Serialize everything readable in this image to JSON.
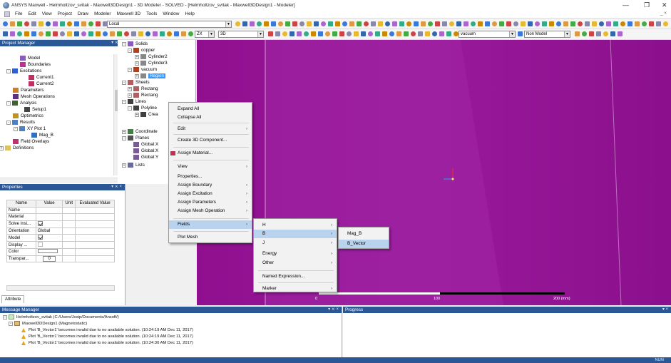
{
  "window": {
    "title": "ANSYS Maxwell - Helmholtzov_svitak - Maxwell3DDesign1 - 3D Modeler - SOLVED - [Helmholtzov_svitak - Maxwell3DDesign1 - Modeler]",
    "minimize": "—",
    "maximize": "❐",
    "close": "✕",
    "inner_controls": "_ ×"
  },
  "menubar": [
    "File",
    "Edit",
    "View",
    "Project",
    "Draw",
    "Modeler",
    "Maxwell 3D",
    "Tools",
    "Window",
    "Help"
  ],
  "toolbar": {
    "coord_system": "Local",
    "plane": "ZX",
    "dimension": "3D",
    "material": "vacuum",
    "model_type": "Non Model"
  },
  "project_manager": {
    "header": "Project Manager",
    "controls": "▾ ⨯ ×",
    "items": [
      {
        "label": "Model",
        "icon": "model-icon"
      },
      {
        "label": "Boundaries",
        "icon": "boundaries-icon"
      },
      {
        "label": "Excitations",
        "icon": "excitations-icon"
      },
      {
        "label": "Current1",
        "icon": "current-icon"
      },
      {
        "label": "Current2",
        "icon": "current-icon"
      },
      {
        "label": "Parameters",
        "icon": "parameters-icon"
      },
      {
        "label": "Mesh Operations",
        "icon": "mesh-icon"
      },
      {
        "label": "Analysis",
        "icon": "analysis-icon"
      },
      {
        "label": "Setup1",
        "icon": "setup-icon"
      },
      {
        "label": "Optimetrics",
        "icon": "optimetrics-icon"
      },
      {
        "label": "Results",
        "icon": "results-icon"
      },
      {
        "label": "XY Plot 1",
        "icon": "plot-icon"
      },
      {
        "label": "Mag_B",
        "icon": "trace-icon"
      },
      {
        "label": "Field Overlays",
        "icon": "field-icon"
      },
      {
        "label": "Definitions",
        "icon": "folder-icon"
      }
    ]
  },
  "object_tree": {
    "items": [
      {
        "label": "Solids"
      },
      {
        "label": "copper"
      },
      {
        "label": "Cylinder2"
      },
      {
        "label": "Cylinder3"
      },
      {
        "label": "vacuum"
      },
      {
        "label": "Region"
      },
      {
        "label": "Sheets"
      },
      {
        "label": "Rectang"
      },
      {
        "label": "Rectang"
      },
      {
        "label": "Lines"
      },
      {
        "label": "Polyline"
      },
      {
        "label": "Crea"
      },
      {
        "label": "Coordinate"
      },
      {
        "label": "Planes"
      },
      {
        "label": "Global:X"
      },
      {
        "label": "Global:X"
      },
      {
        "label": "Global:Y"
      },
      {
        "label": "Lists"
      }
    ]
  },
  "properties": {
    "header": "Properties",
    "controls": "▾ ⨯ ×",
    "columns": [
      "Name",
      "Value",
      "Unit",
      "Evaluated Value"
    ],
    "rows": [
      {
        "name": "Name",
        "value": ""
      },
      {
        "name": "Material",
        "value": ""
      },
      {
        "name": "Solve Insi...",
        "value": "",
        "check": "on"
      },
      {
        "name": "Orientation",
        "value": "Global"
      },
      {
        "name": "Model",
        "value": "",
        "check": "on"
      },
      {
        "name": "Display ...",
        "value": "",
        "check": "dis"
      },
      {
        "name": "Color",
        "value": ""
      },
      {
        "name": "Transpar...",
        "value": "0"
      }
    ],
    "tab": "Attribute"
  },
  "context_menu_1": {
    "items": [
      {
        "label": "Expand All"
      },
      {
        "label": "Collapse All"
      },
      {
        "label": "Edit",
        "sub": true
      },
      {
        "label": "Create 3D Component..."
      },
      {
        "label": "Assign Material..."
      },
      {
        "label": "View",
        "sub": true
      },
      {
        "label": "Properties..."
      },
      {
        "label": "Assign Boundary",
        "sub": true
      },
      {
        "label": "Assign Excitation",
        "sub": true
      },
      {
        "label": "Assign Parameters",
        "sub": true
      },
      {
        "label": "Assign Mesh Operation",
        "sub": true
      },
      {
        "label": "Fields",
        "sub": true
      },
      {
        "label": "Plot Mesh"
      }
    ]
  },
  "context_menu_2": {
    "items": [
      {
        "label": "H",
        "sub": true
      },
      {
        "label": "B",
        "sub": true
      },
      {
        "label": "J",
        "sub": true
      },
      {
        "label": "Energy",
        "sub": true
      },
      {
        "label": "Other",
        "sub": true
      },
      {
        "label": "Named Expression..."
      },
      {
        "label": "Marker",
        "sub": true
      }
    ]
  },
  "context_menu_3": {
    "items": [
      {
        "label": "Mag_B"
      },
      {
        "label": "B_Vector"
      }
    ]
  },
  "scale_bar": {
    "ticks": [
      "0",
      "100",
      "200 (mm)"
    ]
  },
  "message_manager": {
    "header": "Message Manager",
    "controls": "▾ ⨯ ×",
    "project": "Helmholtzov_svitak (C:/Users/Josip/Documents/Ansoft/)",
    "design": "Maxwell3DDesign1 (Magnetostatic)",
    "messages": [
      "Plot 'B_Vector1' becomes invalid due to no available solution. (10:24:19 AM  Dec 11, 2017)",
      "Plot 'B_Vector1' becomes invalid due to no available solution. (10:24:19 AM  Dec 11, 2017)",
      "Plot 'B_Vector1' becomes invalid due to no available solution. (10:24:30 AM  Dec 11, 2017)"
    ]
  },
  "progress": {
    "header": "Progress",
    "controls": "▾ ×"
  },
  "status": {
    "text": "NUM"
  }
}
